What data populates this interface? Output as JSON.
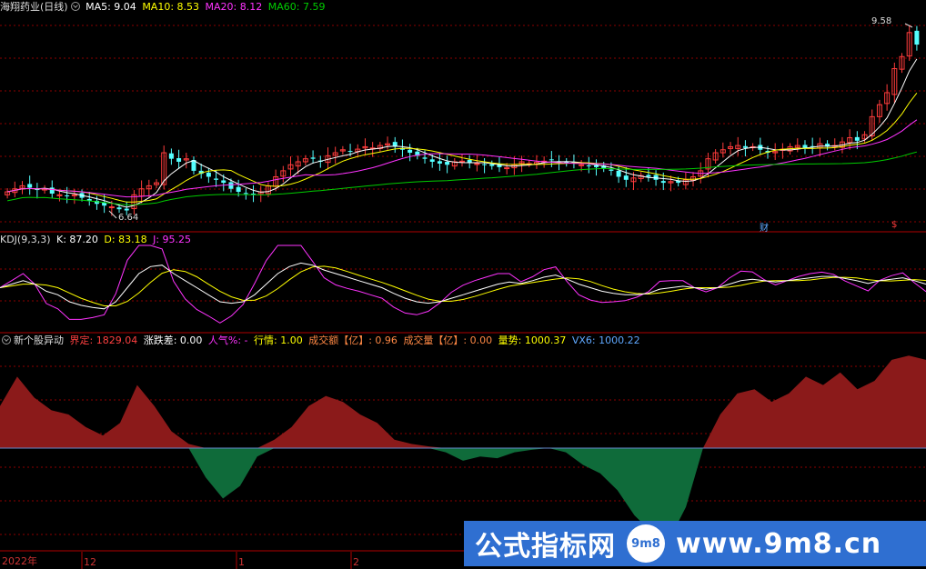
{
  "main_panel": {
    "title": "海翔药业(日线)",
    "ma5": "MA5: 9.04",
    "ma10": "MA10: 8.53",
    "ma20": "MA20: 8.12",
    "ma60": "MA60: 7.59",
    "high_label": "9.58",
    "low_label": "6.64",
    "cai_label": "财",
    "s_label": "$"
  },
  "kdj_panel": {
    "name": "KDJ(9,3,3)",
    "k": "K: 87.20",
    "d": "D: 83.18",
    "j": "J: 95.25"
  },
  "indicator_panel": {
    "name": "新个股异动",
    "jieding": "界定: 1829.04",
    "zhangdiecha": "涨跌差: 0.00",
    "renqi": "人气%: -",
    "hangqing": "行情: 1.00",
    "chengjiaoe": "成交额【亿】: 0.96",
    "chengjiaoliang": "成交量【亿】: 0.00",
    "liangshi": "量势: 1000.37",
    "vx6": "VX6: 1000.22"
  },
  "time_axis": {
    "year": "2022年",
    "m12": "12",
    "m1": "1",
    "m2": "2"
  },
  "watermark": {
    "text1": "公式指标网",
    "logo": "9m8",
    "text2": "www.9m8.cn"
  },
  "colors": {
    "up": "#ff3c3c",
    "down": "#54ffff",
    "ma5": "#ffffff",
    "ma10": "#ffff00",
    "ma20": "#ff33ff",
    "ma60": "#00cc00",
    "area_up": "#8b1a1a",
    "area_down": "#0f6b3a",
    "grid": "#8b0000"
  },
  "chart_data": {
    "type": "candlestick",
    "price_range": [
      6.3,
      9.9
    ],
    "closes": [
      6.95,
      7.0,
      7.05,
      7.02,
      6.98,
      7.0,
      6.92,
      6.9,
      6.88,
      6.9,
      6.85,
      6.8,
      6.75,
      6.72,
      6.7,
      6.66,
      6.64,
      6.9,
      7.0,
      7.05,
      7.1,
      7.6,
      7.5,
      7.45,
      7.5,
      7.3,
      7.25,
      7.2,
      7.15,
      7.1,
      7.0,
      6.95,
      6.92,
      6.9,
      6.95,
      7.05,
      7.2,
      7.3,
      7.4,
      7.45,
      7.5,
      7.5,
      7.45,
      7.55,
      7.6,
      7.65,
      7.62,
      7.66,
      7.7,
      7.68,
      7.72,
      7.75,
      7.7,
      7.65,
      7.6,
      7.55,
      7.5,
      7.45,
      7.42,
      7.4,
      7.45,
      7.46,
      7.44,
      7.42,
      7.4,
      7.38,
      7.36,
      7.35,
      7.4,
      7.45,
      7.42,
      7.44,
      7.46,
      7.48,
      7.45,
      7.43,
      7.42,
      7.4,
      7.38,
      7.36,
      7.34,
      7.3,
      7.2,
      7.15,
      7.18,
      7.22,
      7.2,
      7.15,
      7.1,
      7.12,
      7.1,
      7.15,
      7.2,
      7.3,
      7.5,
      7.6,
      7.65,
      7.7,
      7.72,
      7.68,
      7.7,
      7.65,
      7.6,
      7.62,
      7.66,
      7.7,
      7.72,
      7.68,
      7.7,
      7.75,
      7.7,
      7.72,
      7.78,
      7.85,
      7.8,
      7.9,
      8.2,
      8.4,
      8.6,
      9.0,
      9.2,
      9.6,
      9.4
    ],
    "kdj_range": [
      -10,
      110
    ],
    "k": [
      50,
      55,
      60,
      55,
      45,
      40,
      30,
      25,
      22,
      20,
      30,
      50,
      70,
      80,
      82,
      70,
      60,
      50,
      40,
      30,
      28,
      30,
      40,
      55,
      70,
      80,
      85,
      82,
      75,
      70,
      65,
      60,
      55,
      50,
      42,
      35,
      30,
      28,
      30,
      35,
      40,
      45,
      50,
      55,
      58,
      56,
      60,
      65,
      68,
      62,
      55,
      50,
      45,
      42,
      40,
      40,
      42,
      48,
      50,
      52,
      50,
      48,
      50,
      55,
      60,
      62,
      60,
      58,
      60,
      62,
      64,
      66,
      66,
      63,
      60,
      56,
      60,
      62,
      64,
      60,
      55
    ],
    "indicator_range": [
      -1.2,
      1.2
    ],
    "indicator": [
      0.5,
      0.85,
      0.6,
      0.45,
      0.4,
      0.25,
      0.15,
      0.3,
      0.75,
      0.5,
      0.2,
      0.05,
      -0.35,
      -0.6,
      -0.45,
      -0.1,
      0.1,
      0.25,
      0.5,
      0.62,
      0.55,
      0.4,
      0.3,
      0.1,
      0.05,
      0.02,
      -0.05,
      -0.15,
      -0.1,
      -0.12,
      -0.05,
      -0.02,
      0.0,
      -0.05,
      -0.2,
      -0.3,
      -0.5,
      -0.8,
      -1.0,
      -1.1,
      -0.7,
      0.0,
      0.4,
      0.65,
      0.7,
      0.55,
      0.65,
      0.85,
      0.75,
      0.9,
      0.7,
      0.8,
      1.05,
      1.1,
      1.05
    ]
  }
}
